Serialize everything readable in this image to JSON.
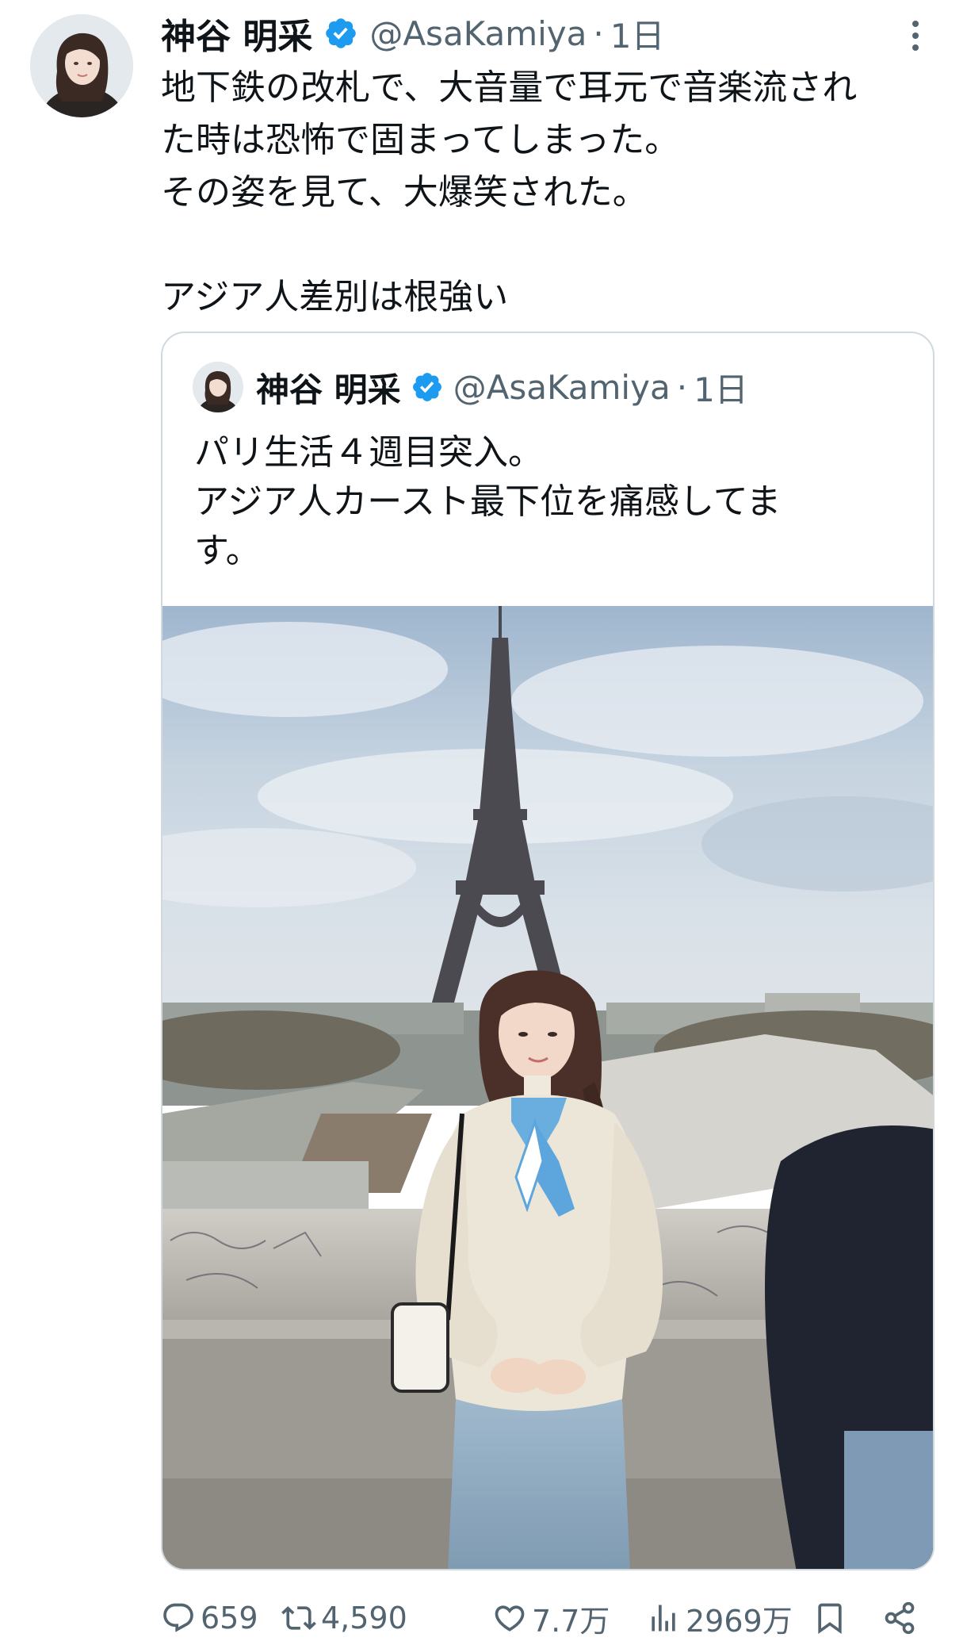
{
  "tweet": {
    "author": {
      "display_name": "神谷 明采",
      "handle": "@AsaKamiya",
      "separator": "·",
      "time": "1日",
      "verified": true
    },
    "text_lines": [
      "地下鉄の改札で、大音量で耳元で音楽流され",
      "た時は恐怖で固まってしまった。",
      "その姿を見て、大爆笑された。",
      "",
      "アジア人差別は根強い"
    ],
    "quoted": {
      "author": {
        "display_name": "神谷 明采",
        "handle": "@AsaKamiya",
        "separator": "·",
        "time": "1日",
        "verified": true
      },
      "text_lines": [
        "パリ生活４週目突入。",
        "アジア人カースト最下位を痛感してま",
        "す。"
      ],
      "media": {
        "type": "photo",
        "content": "woman-in-front-of-eiffel-tower"
      }
    },
    "actions": {
      "replies": "659",
      "retweets": "4,590",
      "likes": "7.7万",
      "views": "2969万"
    }
  },
  "colors": {
    "text": "#0f1419",
    "secondary": "#536471",
    "verified": "#1d9bf0",
    "border": "#cfd9de"
  },
  "icons": {
    "verified": "verified-badge-icon",
    "more": "more-vertical-icon",
    "reply": "reply-icon",
    "retweet": "retweet-icon",
    "like": "heart-icon",
    "views": "views-chart-icon",
    "bookmark": "bookmark-icon",
    "share": "share-icon"
  }
}
